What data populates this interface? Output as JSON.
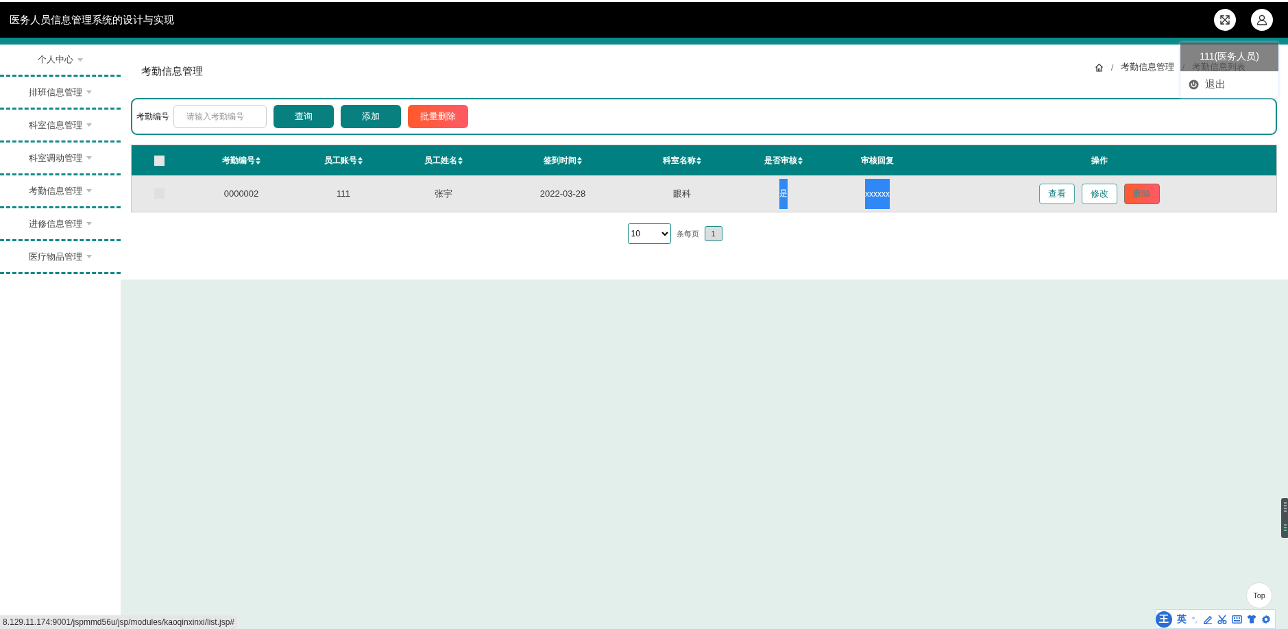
{
  "header": {
    "title": "医务人员信息管理系统的设计与实现"
  },
  "user_menu": {
    "user": "111(医务人员)",
    "items": [
      {
        "label": "退出"
      }
    ]
  },
  "sidebar": {
    "items": [
      {
        "label": "个人中心"
      },
      {
        "label": "排班信息管理"
      },
      {
        "label": "科室信息管理"
      },
      {
        "label": "科室调动管理"
      },
      {
        "label": "考勤信息管理"
      },
      {
        "label": "进修信息管理"
      },
      {
        "label": "医疗物品管理"
      }
    ]
  },
  "page": {
    "title": "考勤信息管理",
    "breadcrumb": [
      {
        "kind": "separator",
        "text": "/"
      },
      {
        "kind": "link",
        "text": "考勤信息管理"
      },
      {
        "kind": "separator",
        "text": "/"
      },
      {
        "kind": "link",
        "text": "考勤信息列表"
      }
    ]
  },
  "search": {
    "label": "考勤编号",
    "placeholder": "请输入考勤编号",
    "buttons": [
      {
        "label": "查询",
        "kind": "primary"
      },
      {
        "label": "添加",
        "kind": "primary"
      },
      {
        "label": "批量删除",
        "kind": "danger"
      }
    ]
  },
  "table": {
    "select_all": {
      "checked": false
    },
    "columns": [
      {
        "label": "考勤编号",
        "sortable": true
      },
      {
        "label": "员工账号",
        "sortable": true
      },
      {
        "label": "员工姓名",
        "sortable": true
      },
      {
        "label": "签到时间",
        "sortable": true
      },
      {
        "label": "科室名称",
        "sortable": true
      },
      {
        "label": "是否审核",
        "sortable": true
      },
      {
        "label": "审核回复",
        "sortable": false
      },
      {
        "label": "操作",
        "sortable": false
      }
    ],
    "rows": [
      {
        "checked": false,
        "cells": [
          "0000002",
          "111",
          "张宇",
          "2022-03-28",
          "眼科"
        ],
        "approved": "是",
        "reply": "xxxxxx",
        "actions": [
          {
            "label": "查看",
            "kind": "outline"
          },
          {
            "label": "修改",
            "kind": "outline"
          },
          {
            "label": "删除",
            "kind": "danger"
          }
        ]
      }
    ]
  },
  "pagination": {
    "page_size": "10",
    "per_page_label": "条每页",
    "pages": [
      {
        "label": "1",
        "selected": true
      }
    ]
  },
  "status_url": "8.129.11.174:9001/jspmmd56u/jsp/modules/kaoqinxinxi/list.jsp#",
  "back_to_top": "Top",
  "ime": {
    "logo": "王",
    "mode": "英"
  }
}
